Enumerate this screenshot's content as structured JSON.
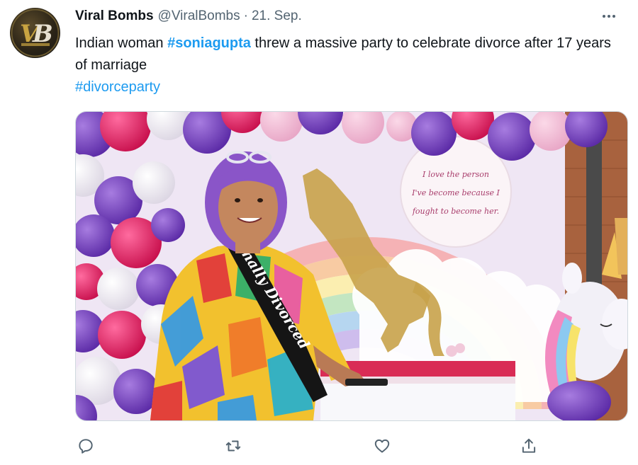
{
  "tweet": {
    "author_name": "Viral Bombs",
    "author_handle": "@ViralBombs",
    "separator": "·",
    "date": "21. Sep.",
    "text_parts": [
      {
        "text": "Indian woman ",
        "style": "plain"
      },
      {
        "text": "#soniagupta",
        "style": "hashtag-bold"
      },
      {
        "text": " threw a massive party to celebrate divorce after 17 years of marriage",
        "style": "plain"
      }
    ],
    "hashtag_line": "#divorceparty",
    "media": {
      "sash_text": "Finally Divorced",
      "sign_text_lines": [
        "I love the person",
        "I've become because I",
        "fought to become her."
      ]
    }
  },
  "icons": {
    "more": "more-horizontal-icon",
    "reply": "reply-icon",
    "retweet": "retweet-icon",
    "like": "like-icon",
    "share": "share-icon"
  },
  "colors": {
    "text": "#0f1419",
    "secondary": "#536471",
    "link": "#1d9bf0"
  }
}
